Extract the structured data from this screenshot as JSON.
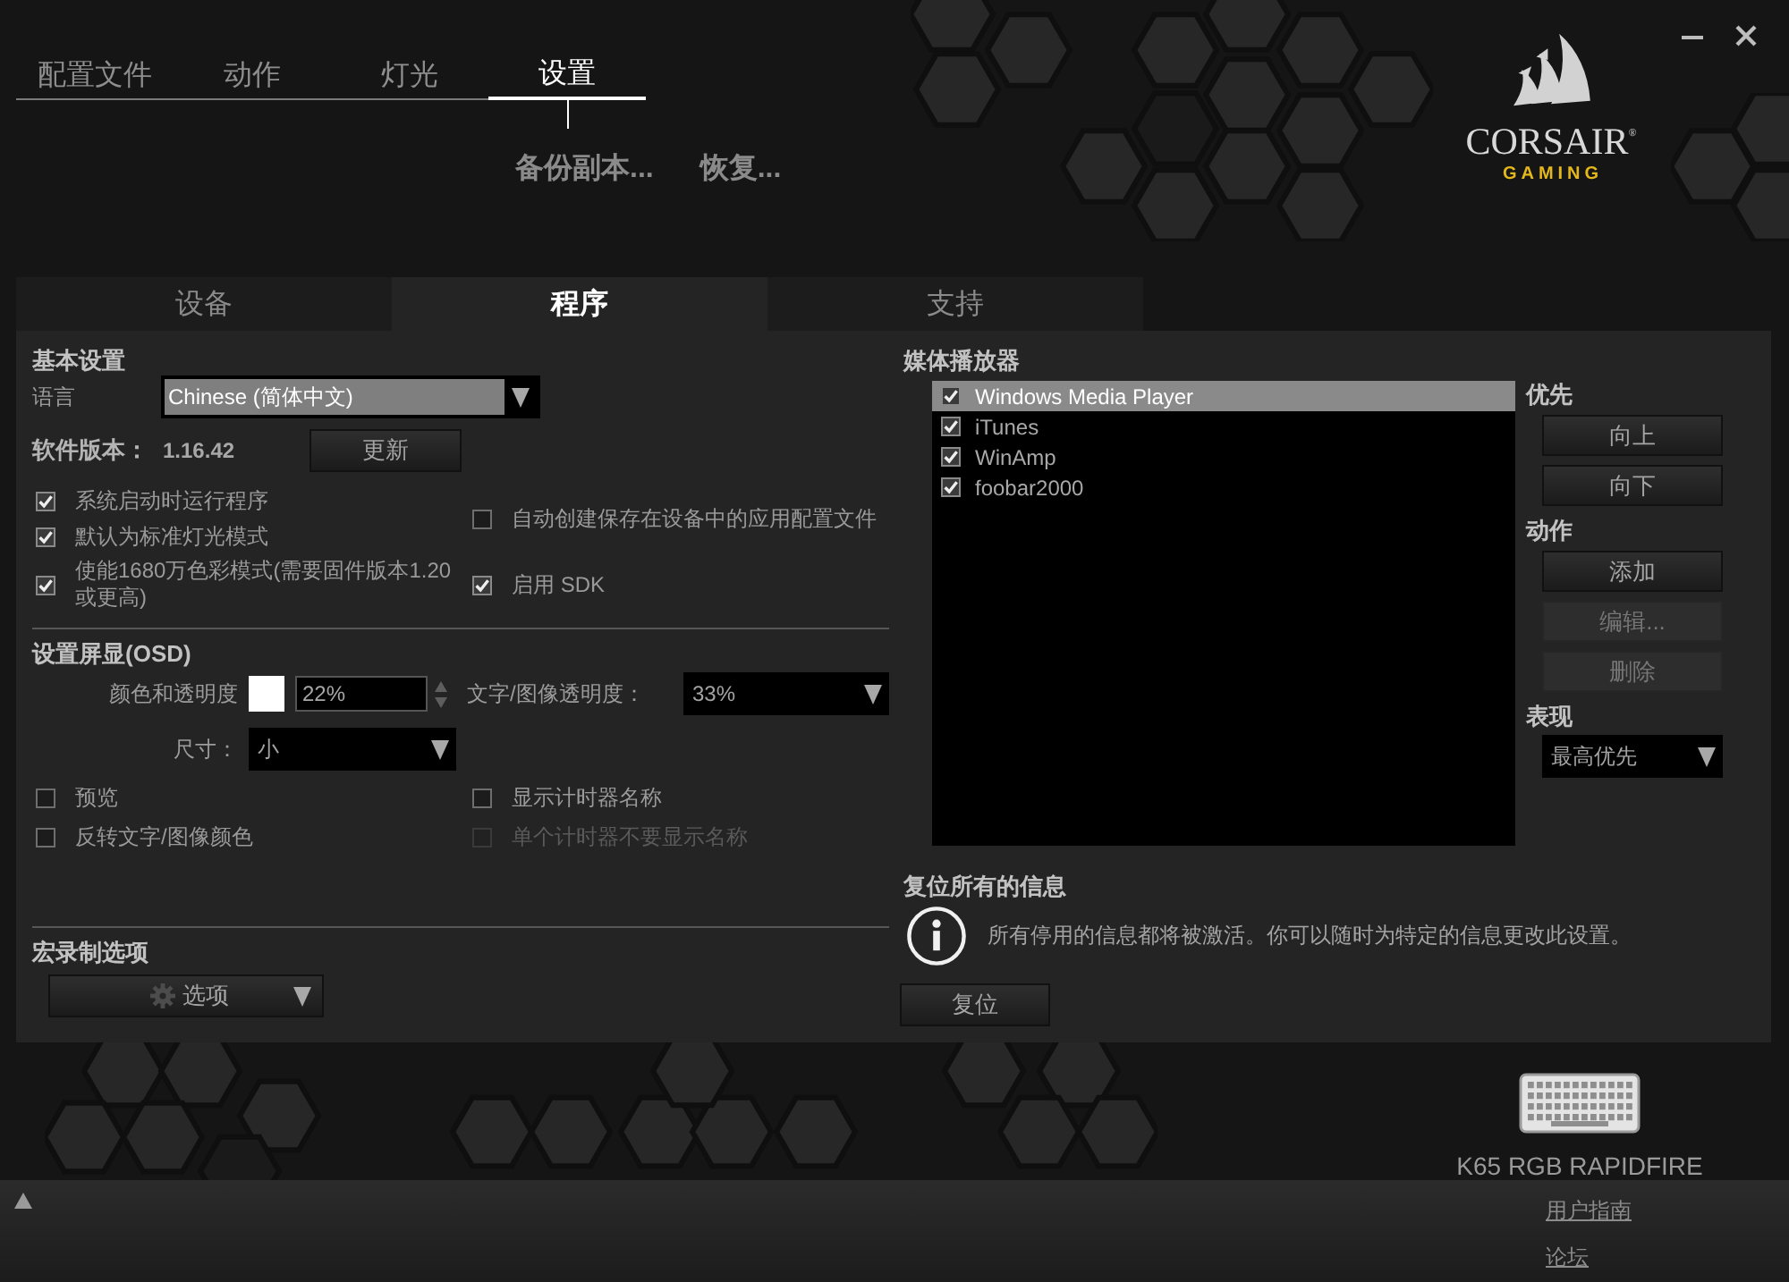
{
  "nav": {
    "tabs": [
      {
        "label": "配置文件",
        "selected": false
      },
      {
        "label": "动作",
        "selected": false
      },
      {
        "label": "灯光",
        "selected": false
      },
      {
        "label": "设置",
        "selected": true
      }
    ],
    "links": [
      "备份副本...",
      "恢复..."
    ]
  },
  "logo": {
    "brand": "CORSAIR$^{®}$",
    "tagline": "GAMING"
  },
  "panel_tabs": [
    {
      "label": "设备",
      "selected": false
    },
    {
      "label": "程序",
      "selected": true
    },
    {
      "label": "支持",
      "selected": false
    }
  ],
  "basic_settings": {
    "title": "基本设置",
    "language_label": "语言",
    "language": "Chinese (简体中文)",
    "version_label": "软件版本：",
    "version": "1.16.42",
    "update_button": "更新",
    "options_column_1": [
      {
        "label": "系统启动时运行程序",
        "checked": true,
        "disabled": false
      },
      {
        "label": "默认为标准灯光模式",
        "checked": true,
        "disabled": false
      },
      {
        "label": "使能1680万色彩模式(需要固件版本1.20或更高)",
        "checked": true,
        "disabled": false
      }
    ],
    "options_column_2": [
      {
        "label": "自动创建保存在设备中的应用配置文件",
        "checked": false,
        "disabled": false
      },
      {
        "label": "启用 SDK",
        "checked": true,
        "disabled": false
      }
    ]
  },
  "osd": {
    "title": "设置屏显(OSD)",
    "color_label": "颜色和透明度",
    "color": "#ffffff",
    "opacity": "22%",
    "text_opacity_label": "文字/图像透明度：",
    "text_opacity": "33%",
    "size_label": "尺寸：",
    "size": "小",
    "options_column_1": [
      {
        "label": "预览",
        "checked": false,
        "disabled": false
      },
      {
        "label": "反转文字/图像颜色",
        "checked": false,
        "disabled": false
      }
    ],
    "options_column_2": [
      {
        "label": "显示计时器名称",
        "checked": false,
        "disabled": false
      },
      {
        "label": "单个计时器不要显示名称",
        "checked": false,
        "disabled": true
      }
    ]
  },
  "macro": {
    "title": "宏录制选项",
    "button": "选项"
  },
  "media_players": {
    "title": "媒体播放器",
    "players": [
      {
        "name": "Windows Media Player",
        "checked": true,
        "selected": true
      },
      {
        "name": "iTunes",
        "checked": true,
        "selected": false
      },
      {
        "name": "WinAmp",
        "checked": true,
        "selected": false
      },
      {
        "name": "foobar2000",
        "checked": true,
        "selected": false
      }
    ],
    "priority_label": "优先",
    "priority_buttons": [
      {
        "label": "向上",
        "disabled": false
      },
      {
        "label": "向下",
        "disabled": false
      }
    ],
    "action_label": "动作",
    "action_buttons": [
      {
        "label": "添加",
        "disabled": false
      },
      {
        "label": "编辑...",
        "disabled": true
      },
      {
        "label": "删除",
        "disabled": true
      }
    ],
    "behavior_label": "表现",
    "behavior": "最高优先"
  },
  "reset_messages": {
    "title": "复位所有的信息",
    "message": "所有停用的信息都将被激活。你可以随时为特定的信息更改此设置。",
    "button": "复位"
  },
  "device": {
    "name": "K65 RGB RAPIDFIRE"
  },
  "footer": {
    "links": [
      "用户指南",
      "论坛"
    ]
  }
}
